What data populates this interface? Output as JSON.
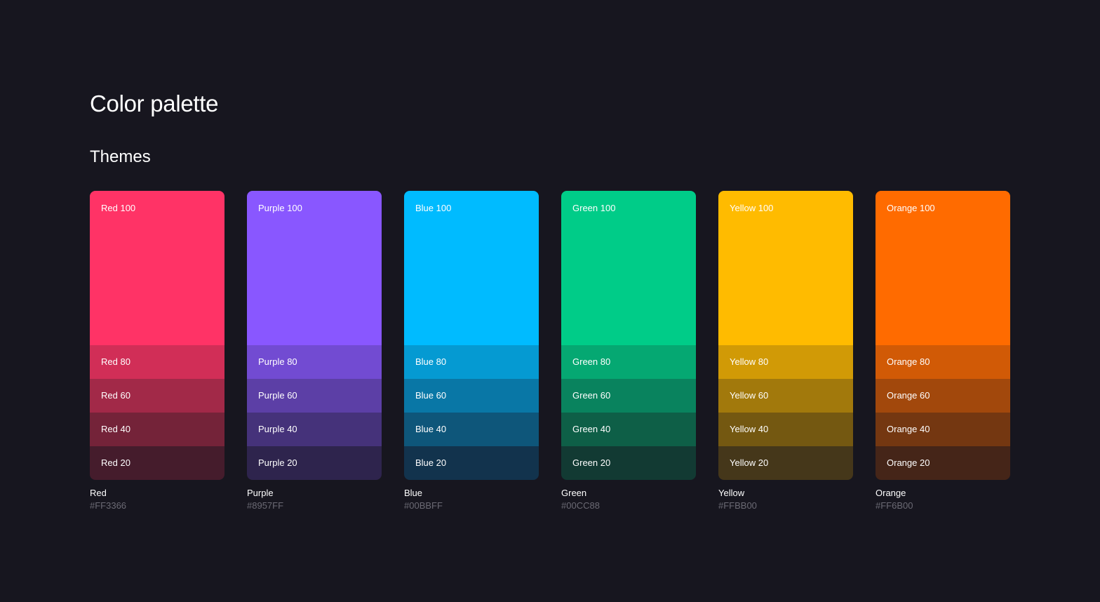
{
  "page": {
    "title": "Color palette",
    "section": "Themes",
    "background": "#17161F"
  },
  "palettes": [
    {
      "name": "Red",
      "hex": "#FF3366",
      "shades": [
        {
          "label": "Red 100",
          "color": "#FF3366"
        },
        {
          "label": "Red 80",
          "color": "#D12E57"
        },
        {
          "label": "Red 60",
          "color": "#A22948"
        },
        {
          "label": "Red 40",
          "color": "#742339"
        },
        {
          "label": "Red 20",
          "color": "#451C2C"
        }
      ]
    },
    {
      "name": "Purple",
      "hex": "#8957FF",
      "shades": [
        {
          "label": "Purple 100",
          "color": "#8957FF"
        },
        {
          "label": "Purple 80",
          "color": "#724BD2"
        },
        {
          "label": "Purple 60",
          "color": "#5C3FA6"
        },
        {
          "label": "Purple 40",
          "color": "#45327A"
        },
        {
          "label": "Purple 20",
          "color": "#2E244D"
        }
      ]
    },
    {
      "name": "Blue",
      "hex": "#00BBFF",
      "shades": [
        {
          "label": "Blue 100",
          "color": "#00BBFF"
        },
        {
          "label": "Blue 80",
          "color": "#059AD2"
        },
        {
          "label": "Blue 60",
          "color": "#0977A6"
        },
        {
          "label": "Blue 40",
          "color": "#0E567A"
        },
        {
          "label": "Blue 20",
          "color": "#12334D"
        }
      ]
    },
    {
      "name": "Green",
      "hex": "#00CC88",
      "shades": [
        {
          "label": "Green 100",
          "color": "#00CC88"
        },
        {
          "label": "Green 80",
          "color": "#05A872"
        },
        {
          "label": "Green 60",
          "color": "#09835E"
        },
        {
          "label": "Green 40",
          "color": "#0E5F47"
        },
        {
          "label": "Green 20",
          "color": "#123A33"
        }
      ]
    },
    {
      "name": "Yellow",
      "hex": "#FFBB00",
      "shades": [
        {
          "label": "Yellow 100",
          "color": "#FFBB00"
        },
        {
          "label": "Yellow 80",
          "color": "#D19A06"
        },
        {
          "label": "Yellow 60",
          "color": "#A2790C"
        },
        {
          "label": "Yellow 40",
          "color": "#745811"
        },
        {
          "label": "Yellow 20",
          "color": "#45371A"
        }
      ]
    },
    {
      "name": "Orange",
      "hex": "#FF6B00",
      "shades": [
        {
          "label": "Orange 100",
          "color": "#FF6B00"
        },
        {
          "label": "Orange 80",
          "color": "#D15A06"
        },
        {
          "label": "Orange 60",
          "color": "#A2480C"
        },
        {
          "label": "Orange 40",
          "color": "#743711"
        },
        {
          "label": "Orange 20",
          "color": "#452518"
        }
      ]
    }
  ]
}
